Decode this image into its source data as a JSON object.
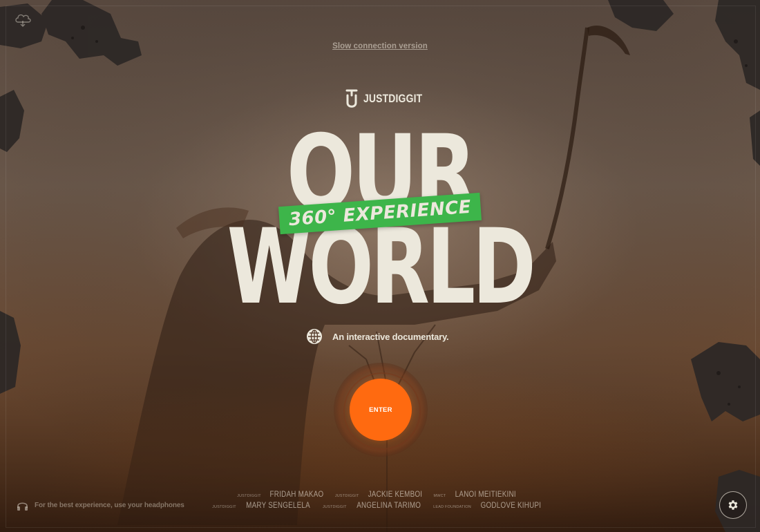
{
  "links": {
    "slow_connection": "Slow connection version"
  },
  "brand": {
    "name": "JUSTDIGGIT"
  },
  "title": {
    "line1": "OUR",
    "line2": "WORLD",
    "badge": "360° EXPERIENCE"
  },
  "tagline": "An interactive documentary.",
  "enter": {
    "label": "ENTER"
  },
  "headphones_note": "For the best experience, use your headphones",
  "credits": {
    "row1": [
      {
        "org": "Justdiggit",
        "name": "FRIDAH MAKAO"
      },
      {
        "org": "Justdiggit",
        "name": "JACKIE KEMBOI"
      },
      {
        "org": "MWCT",
        "name": "LANOI MEITIEKINI"
      }
    ],
    "row2": [
      {
        "org": "Justdiggit",
        "name": "MARY SENGELELA"
      },
      {
        "org": "Justdiggit",
        "name": "ANGELINA TARIMO"
      },
      {
        "org": "Lead Foundation",
        "name": "GODLOVE KIHUPI"
      }
    ]
  },
  "icons": {
    "top_left": "cloud-download-icon",
    "brand": "justdiggit-logo-icon",
    "globe": "globe-icon",
    "headphones": "headphones-icon",
    "settings": "gear-icon"
  },
  "colors": {
    "accent": "#ff6a10",
    "badge": "#3db54a",
    "text": "#ece8dc"
  }
}
